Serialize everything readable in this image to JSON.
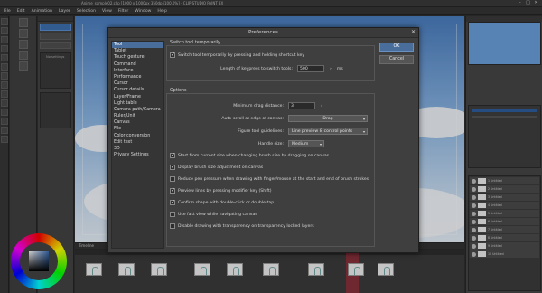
{
  "window": {
    "title": "Anime_sample02.clip [1000 x 1000px 350dpi 100.0%] - CLIP STUDIO PAINT EX"
  },
  "menu": [
    "File",
    "Edit",
    "Animation",
    "Layer",
    "Selection",
    "View",
    "Filter",
    "Window",
    "Help"
  ],
  "left_panel": {
    "subtool_empty": "No settings"
  },
  "timeline": {
    "tab": "Timeline"
  },
  "layer_items": [
    "1 Untitled",
    "2 Untitled",
    "3 Untitled",
    "4 Untitled",
    "5 Untitled",
    "6 Untitled",
    "7 Untitled",
    "8 Untitled",
    "9 Untitled",
    "10 Untitled"
  ],
  "dialog": {
    "title": "Preferences",
    "ok": "OK",
    "cancel": "Cancel",
    "categories": [
      "Tool",
      "Tablet",
      "Touch gesture",
      "Command",
      "Interface",
      "Performance",
      "Cursor",
      "Cursor details",
      "Layer/Frame",
      "Light table",
      "Camera path/Camera",
      "Ruler/Unit",
      "Canvas",
      "File",
      "Color conversion",
      "Edit text",
      "3D",
      "Privacy Settings"
    ],
    "switch_group": {
      "title": "Switch tool temporarily",
      "checkbox_label": "Switch tool temporarily by pressing and holding shortcut key",
      "checked": true,
      "keypress_label": "Length of keypress to switch tools:",
      "keypress_value": "500",
      "keypress_unit": "ms"
    },
    "options_group": {
      "title": "Options",
      "min_drag_label": "Minimum drag distance:",
      "min_drag_value": "3",
      "autoscroll_label": "Auto-scroll at edge of canvas:",
      "autoscroll_value": "Drag",
      "figure_label": "Figure tool guidelines:",
      "figure_value": "Line preview & control points",
      "handle_label": "Handle size:",
      "handle_value": "Medium",
      "checks": [
        {
          "label": "Start from current size when changing brush size by dragging on canvas",
          "checked": true
        },
        {
          "label": "Display brush size adjustment on canvas",
          "checked": true
        },
        {
          "label": "Reduce pen pressure when drawing with finger/mouse at the start and end of brush strokes",
          "checked": false
        },
        {
          "label": "Preview lines by pressing modifier key (Shift)",
          "checked": true
        },
        {
          "label": "Confirm shape with double-click or double-tap",
          "checked": true
        },
        {
          "label": "Use fast view while navigating canvas",
          "checked": false
        },
        {
          "label": "Disable drawing with transparency on transparency locked layers",
          "checked": false
        }
      ]
    }
  }
}
